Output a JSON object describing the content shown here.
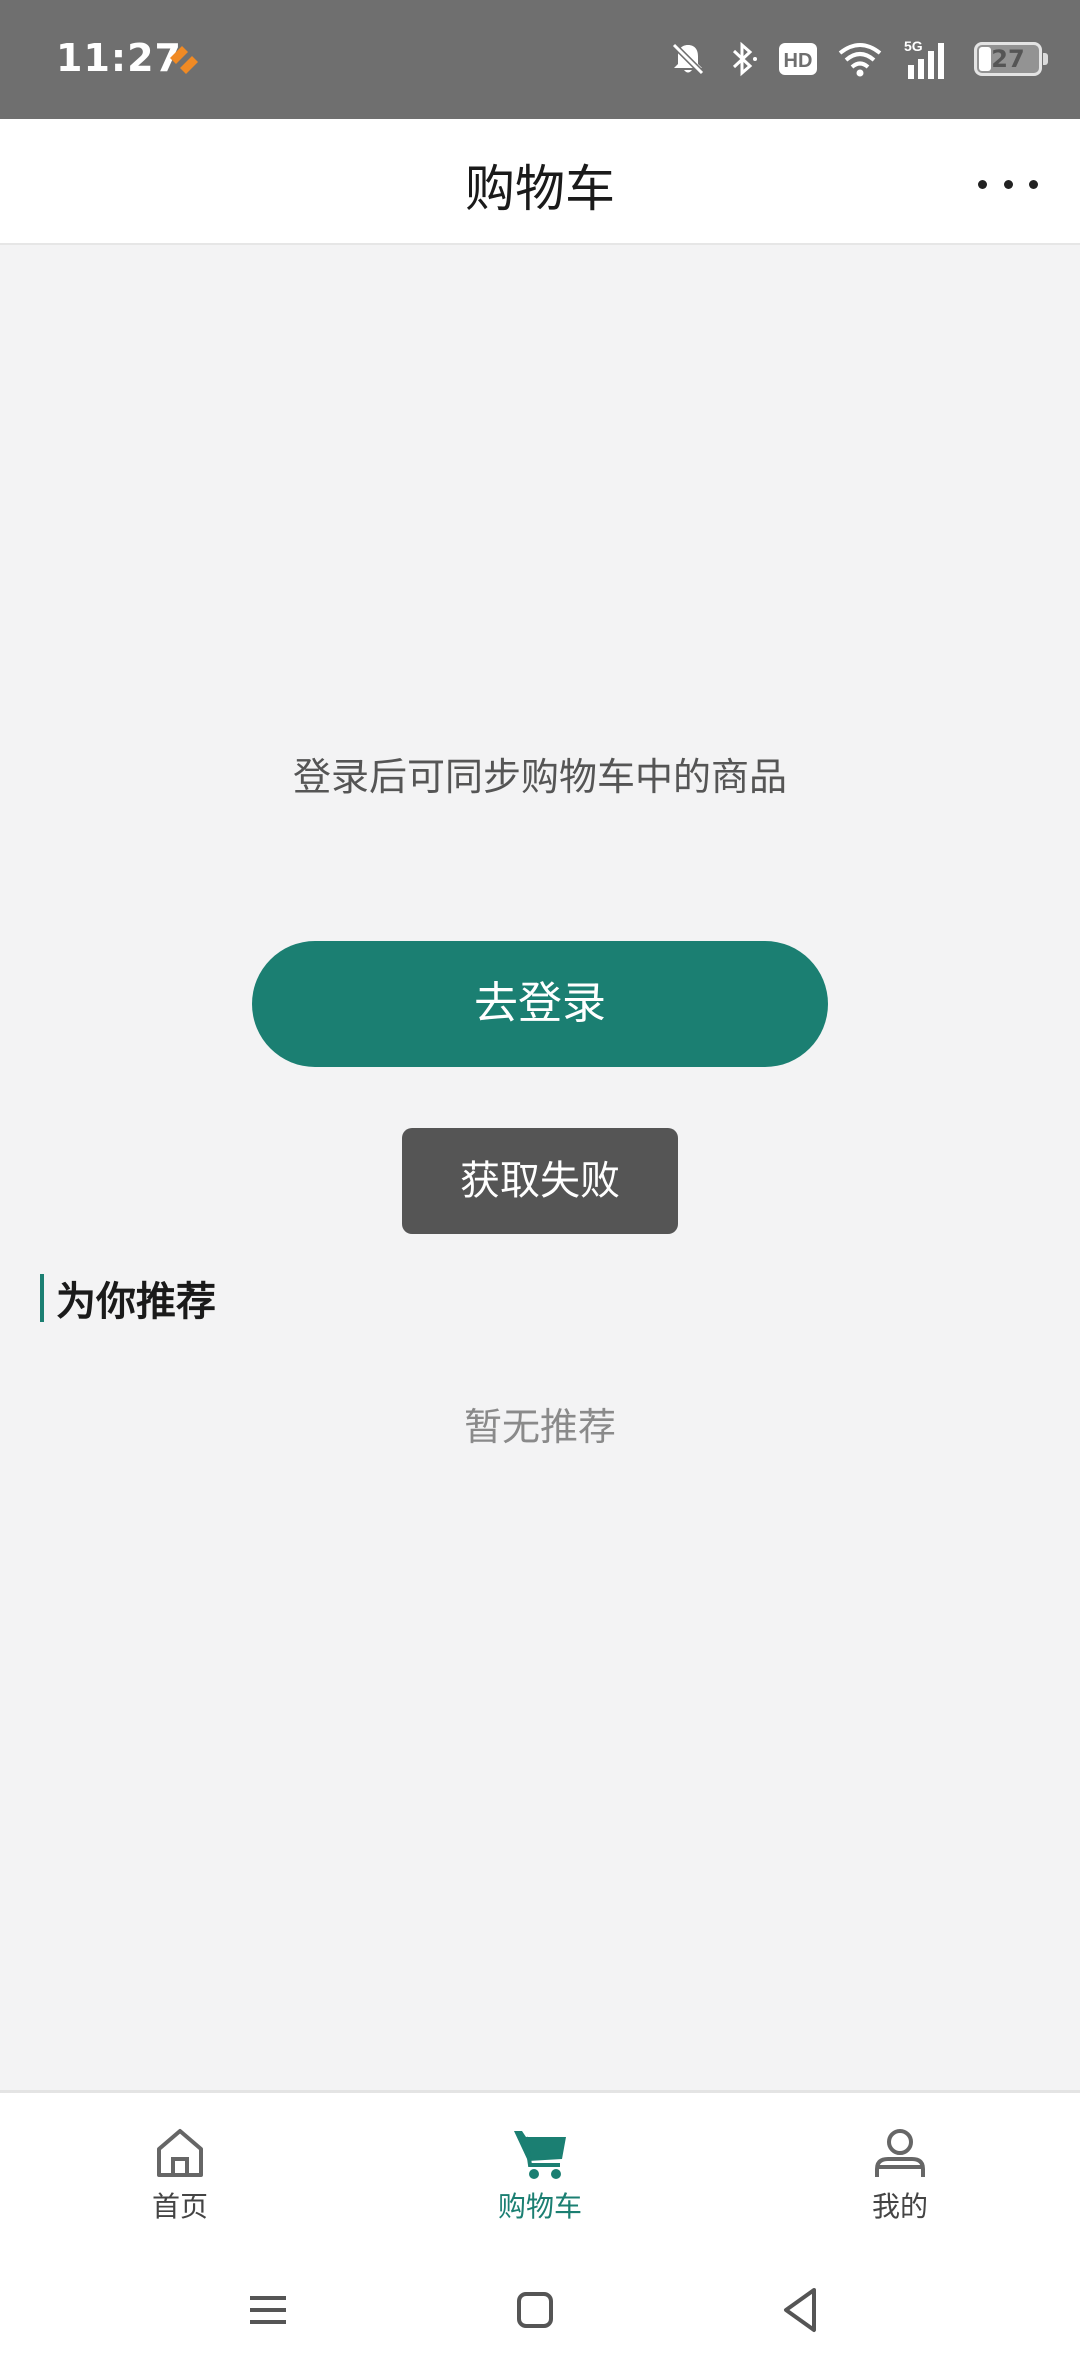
{
  "status_bar": {
    "time": "11:27",
    "battery_level": "27",
    "icons": [
      "app-notification-icon",
      "mute-bell-icon",
      "bluetooth-icon",
      "hd-icon",
      "wifi-icon",
      "signal-5g-icon",
      "battery-icon"
    ]
  },
  "header": {
    "title": "购物车"
  },
  "main": {
    "login_hint": "登录后可同步购物车中的商品",
    "login_button": "去登录",
    "toast": "获取失败",
    "recommend_title": "为你推荐",
    "recommend_empty": "暂无推荐"
  },
  "tabs": [
    {
      "label": "首页",
      "icon": "home-icon",
      "active": false
    },
    {
      "label": "购物车",
      "icon": "cart-icon",
      "active": true
    },
    {
      "label": "我的",
      "icon": "user-icon",
      "active": false
    }
  ],
  "colors": {
    "accent": "#1b7f72",
    "status_bar": "#6f6f6f",
    "background": "#f3f3f4",
    "toast": "#555555"
  }
}
